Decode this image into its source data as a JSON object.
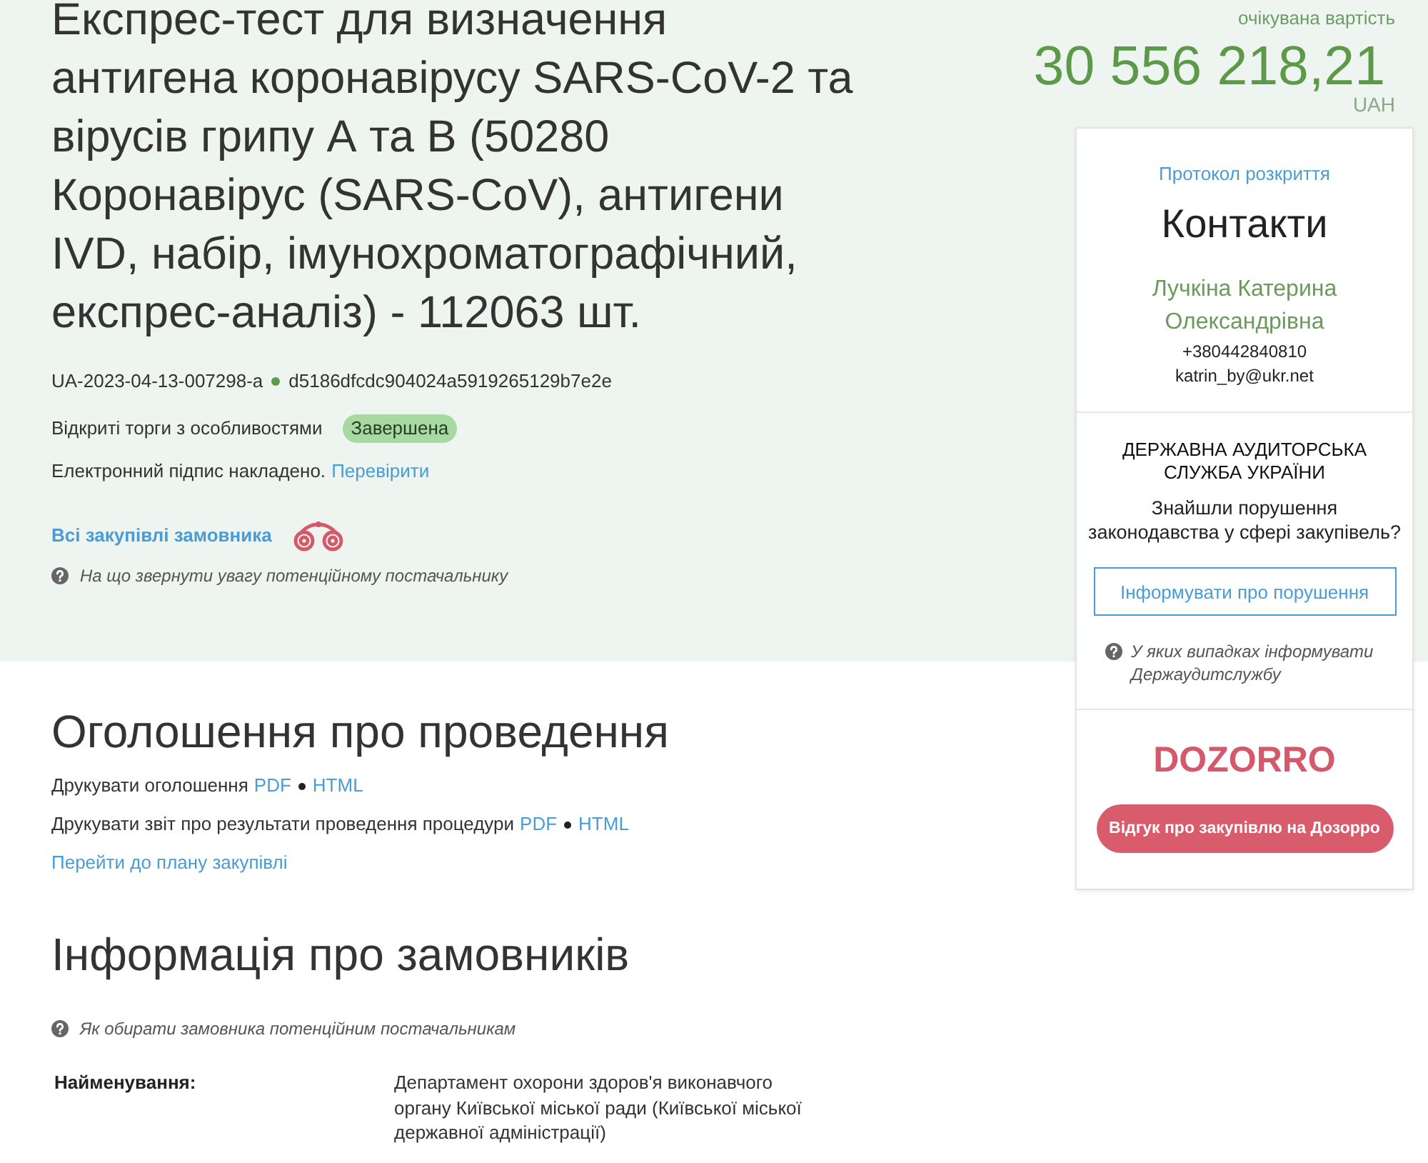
{
  "tender": {
    "title": "Експрес-тест для визначення антигена коронавірусу SARS-CoV-2 та вірусів грипу А та В (50280 Коронавірус (SARS-CoV), антигени IVD, набір, імунохроматографічний, експрес-аналіз) - 112063 шт.",
    "id": "UA-2023-04-13-007298-a",
    "hash": "d5186dfcdc904024a5919265129b7e2e",
    "procedure": "Відкриті торги з особливостями",
    "status": "Завершена",
    "signature": {
      "text": "Електронний підпис накладено.",
      "link": "Перевірити"
    },
    "customer_link": "Всі закупівлі замовника",
    "hint": "На що звернути увагу потенційному постачальнику"
  },
  "value": {
    "caption": "очікувана вартість",
    "amount": "30 556 218,21",
    "currency": "UAH"
  },
  "contacts": {
    "protocol_link": "Протокол розкриття",
    "heading": "Контакти",
    "name": "Лучкіна Катерина Олександрівна",
    "phone": "+380442840810",
    "email": "katrin_by@ukr.net"
  },
  "audit": {
    "title": "ДЕРЖАВНА АУДИТОРСЬКА СЛУЖБА УКРАЇНИ",
    "question": "Знайшли порушення законодавства у сфері закупівель?",
    "button": "Інформувати про порушення",
    "hint": "У яких випадках інформувати Держаудитслужбу"
  },
  "dozorro": {
    "logo": "DOZORRO",
    "button": "Відгук про закупівлю на Дозорро"
  },
  "announcement": {
    "heading": "Оголошення про проведення",
    "print_rows": [
      {
        "label": "Друкувати оголошення",
        "links": [
          "PDF",
          "HTML"
        ]
      },
      {
        "label": "Друкувати звіт про результати проведення процедури",
        "links": [
          "PDF",
          "HTML"
        ]
      }
    ],
    "plan_link": "Перейти до плану закупівлі"
  },
  "customers": {
    "heading": "Інформація про замовників",
    "hint": "Як обирати замовника потенційним постачальникам",
    "fields": [
      {
        "label": "Найменування:",
        "value": "Департамент охорони здоров'я виконавчого органу Київської міської ради (Київської міської державної адміністрації)"
      }
    ]
  }
}
